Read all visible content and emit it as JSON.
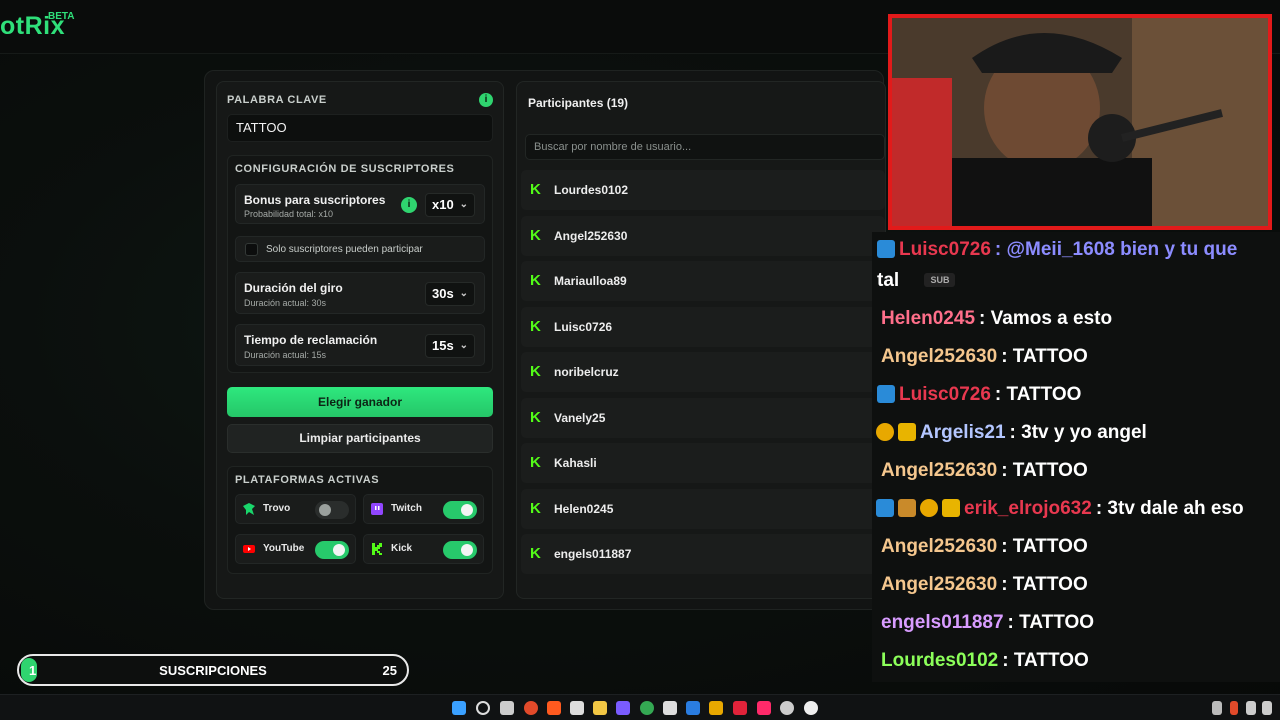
{
  "app": {
    "logo": "otRix",
    "beta": "BETA"
  },
  "keyword": {
    "label": "PALABRA CLAVE",
    "value": "TATTOO",
    "info_icon": "i"
  },
  "subscribers": {
    "title": "CONFIGURACIÓN DE SUSCRIPTORES",
    "bonus": {
      "label": "Bonus para suscriptores",
      "sub": "Probabilidad total: x10",
      "value": "x10"
    },
    "only_subs": {
      "label": "Solo suscriptores pueden participar"
    },
    "spin": {
      "label": "Duración del giro",
      "sub": "Duración actual: 30s",
      "value": "30s"
    },
    "claim": {
      "label": "Tiempo de reclamación",
      "sub": "Duración actual: 15s",
      "value": "15s"
    }
  },
  "buttons": {
    "pick_winner": "Elegir ganador",
    "clear": "Limpiar participantes"
  },
  "platforms": {
    "title": "PLATAFORMAS ACTIVAS",
    "items": [
      {
        "name": "Trovo",
        "on": false,
        "color": "#19d66b"
      },
      {
        "name": "Twitch",
        "on": true,
        "color": "#9146ff"
      },
      {
        "name": "YouTube",
        "on": true,
        "color": "#ff0000"
      },
      {
        "name": "Kick",
        "on": true,
        "color": "#53fc18"
      }
    ]
  },
  "participants": {
    "title": "Participantes (19)",
    "search_placeholder": "Buscar por nombre de usuario...",
    "list": [
      "Lourdes0102",
      "Angel252630",
      "Mariaulloa89",
      "Luisc0726",
      "noribelcruz",
      "Vanely25",
      "Kahasli",
      "Helen0245",
      "engels011887"
    ]
  },
  "chat": [
    {
      "user": "Luisc0726",
      "color": "#e8384f",
      "msg": ": @Meii_1608 bien y tu que",
      "cont": "tal",
      "mention_color": "#8c8cff"
    },
    {
      "user": "Helen0245",
      "color": "#ff6f8a",
      "msg": ": Vamos a esto"
    },
    {
      "user": "Angel252630",
      "color": "#f5c78e",
      "msg": ": TATTOO"
    },
    {
      "user": "Luisc0726",
      "color": "#e8384f",
      "msg": ": TATTOO"
    },
    {
      "user": "Argelis21",
      "color": "#b3c6ff",
      "msg": ": 3tv y yo angel"
    },
    {
      "user": "Angel252630",
      "color": "#f5c78e",
      "msg": ": TATTOO"
    },
    {
      "user": "erik_elrojo632",
      "color": "#e8384f",
      "msg": ": 3tv dale ah eso"
    },
    {
      "user": "Angel252630",
      "color": "#f5c78e",
      "msg": ": TATTOO"
    },
    {
      "user": "Angel252630",
      "color": "#f5c78e",
      "msg": ": TATTOO"
    },
    {
      "user": "engels011887",
      "color": "#d89cff",
      "msg": ": TATTOO"
    },
    {
      "user": "Lourdes0102",
      "color": "#8cff5a",
      "msg": ": TATTOO"
    }
  ],
  "sub_badge": "SUB",
  "subs_goal": {
    "current": "1",
    "label": "SUSCRIPCIONES",
    "target": "25",
    "progress": 0.04
  }
}
